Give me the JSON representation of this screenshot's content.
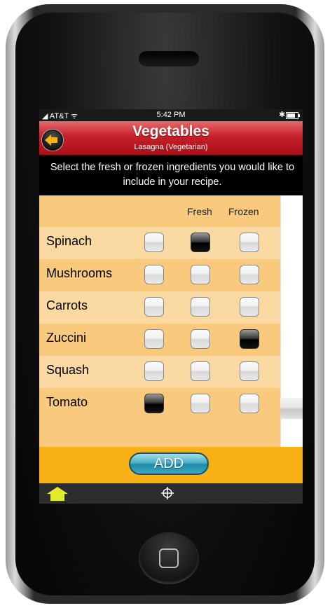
{
  "status_bar": {
    "carrier": "◢ AT&T ᯤ",
    "time": "5:42 PM",
    "bluetooth": "✱"
  },
  "header": {
    "title": "Vegetables",
    "subtitle": "Lasagna (Vegetarian)",
    "back_icon": "back-arrow-icon"
  },
  "instruction": "Select the fresh or frozen ingredients you would like to include in your recipe.",
  "columns": [
    "",
    "Fresh",
    "Frozen"
  ],
  "rows": [
    {
      "label": "Spinach",
      "checks": [
        false,
        true,
        false
      ]
    },
    {
      "label": "Mushrooms",
      "checks": [
        false,
        false,
        false
      ]
    },
    {
      "label": "Carrots",
      "checks": [
        false,
        false,
        false
      ]
    },
    {
      "label": "Zuccini",
      "checks": [
        false,
        false,
        true
      ]
    },
    {
      "label": "Squash",
      "checks": [
        false,
        false,
        false
      ]
    },
    {
      "label": "Tomato",
      "checks": [
        true,
        false,
        false
      ]
    }
  ],
  "add_button": "ADD",
  "tabbar": {
    "home_icon": "home-icon",
    "target_icon": "crosshair-icon"
  },
  "colors": {
    "title_bar": "#c6212a",
    "table_bg": "#f9c97d",
    "add_bar": "#f8b116",
    "add_button": "#3faac5",
    "home_icon": "#e3ec2a"
  }
}
